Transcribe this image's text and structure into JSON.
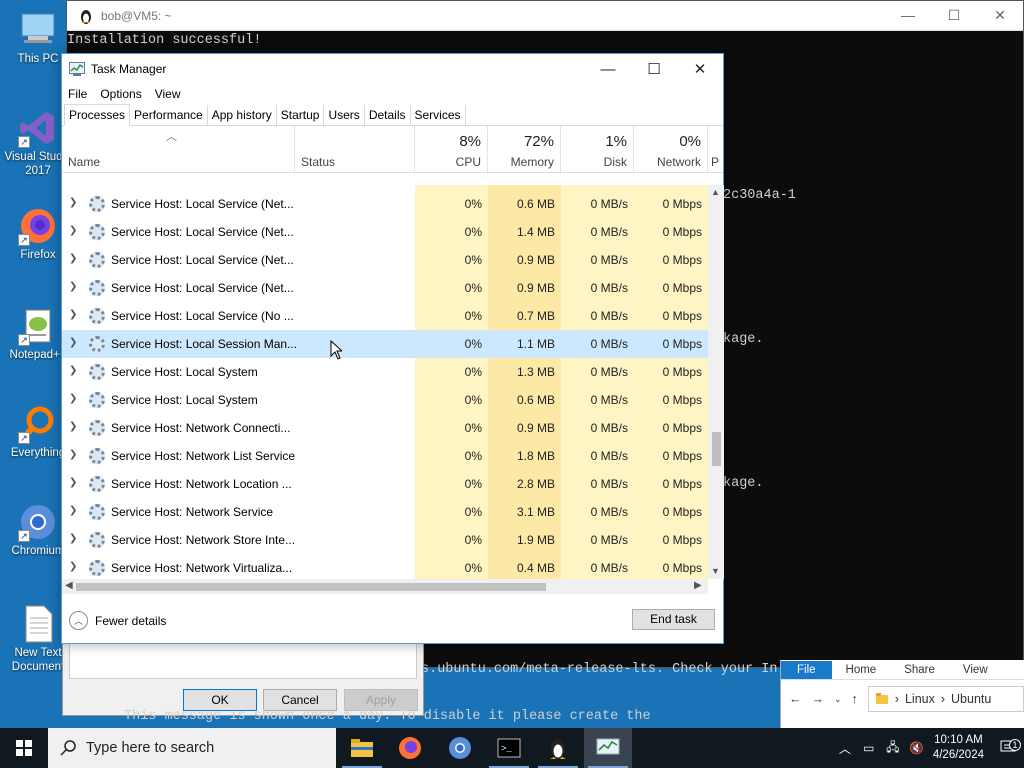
{
  "desktop": {
    "icons": [
      {
        "label": "This PC"
      },
      {
        "label": "Visual Studio 2017"
      },
      {
        "label": "Firefox"
      },
      {
        "label": "Notepad++"
      },
      {
        "label": "Everything"
      },
      {
        "label": "Chromium"
      },
      {
        "label": "New Text Document"
      }
    ]
  },
  "terminal": {
    "title": "bob@VM5: ~",
    "lines": {
      "l1": "Installation successful!",
      "l2": "2c30a4a-1",
      "l3": "kage.",
      "l4": "kage.",
      "l5": "s.ubuntu.com/meta-release-lts. Check your In",
      "l6": "This message is shown once a day. To disable it please create the"
    }
  },
  "explorer": {
    "tabs": [
      "File",
      "Home",
      "Share",
      "View"
    ],
    "path": [
      "Linux",
      "Ubuntu"
    ]
  },
  "properties_dialog": {
    "ok": "OK",
    "cancel": "Cancel",
    "apply": "Apply"
  },
  "task_manager": {
    "title": "Task Manager",
    "menu": [
      "File",
      "Options",
      "View"
    ],
    "tabs": [
      "Processes",
      "Performance",
      "App history",
      "Startup",
      "Users",
      "Details",
      "Services"
    ],
    "active_tab": "Processes",
    "columns": {
      "name": "Name",
      "status": "Status",
      "cpu": {
        "pct": "8%",
        "label": "CPU"
      },
      "memory": {
        "pct": "72%",
        "label": "Memory"
      },
      "disk": {
        "pct": "1%",
        "label": "Disk"
      },
      "network": {
        "pct": "0%",
        "label": "Network"
      },
      "power": "P"
    },
    "rows": [
      {
        "name": "Service Host: Local Service (Net...",
        "cpu": "0%",
        "memory": "0.6 MB",
        "disk": "0 MB/s",
        "network": "0 Mbps"
      },
      {
        "name": "Service Host: Local Service (Net...",
        "cpu": "0%",
        "memory": "1.4 MB",
        "disk": "0 MB/s",
        "network": "0 Mbps"
      },
      {
        "name": "Service Host: Local Service (Net...",
        "cpu": "0%",
        "memory": "0.9 MB",
        "disk": "0 MB/s",
        "network": "0 Mbps"
      },
      {
        "name": "Service Host: Local Service (Net...",
        "cpu": "0%",
        "memory": "0.9 MB",
        "disk": "0 MB/s",
        "network": "0 Mbps"
      },
      {
        "name": "Service Host: Local Service (No ...",
        "cpu": "0%",
        "memory": "0.7 MB",
        "disk": "0 MB/s",
        "network": "0 Mbps"
      },
      {
        "name": "Service Host: Local Session Man...",
        "cpu": "0%",
        "memory": "1.1 MB",
        "disk": "0 MB/s",
        "network": "0 Mbps",
        "selected": true
      },
      {
        "name": "Service Host: Local System",
        "cpu": "0%",
        "memory": "1.3 MB",
        "disk": "0 MB/s",
        "network": "0 Mbps"
      },
      {
        "name": "Service Host: Local System",
        "cpu": "0%",
        "memory": "0.6 MB",
        "disk": "0 MB/s",
        "network": "0 Mbps"
      },
      {
        "name": "Service Host: Network Connecti...",
        "cpu": "0%",
        "memory": "0.9 MB",
        "disk": "0 MB/s",
        "network": "0 Mbps"
      },
      {
        "name": "Service Host: Network List Service",
        "cpu": "0%",
        "memory": "1.8 MB",
        "disk": "0 MB/s",
        "network": "0 Mbps"
      },
      {
        "name": "Service Host: Network Location ...",
        "cpu": "0%",
        "memory": "2.8 MB",
        "disk": "0 MB/s",
        "network": "0 Mbps"
      },
      {
        "name": "Service Host: Network Service",
        "cpu": "0%",
        "memory": "3.1 MB",
        "disk": "0 MB/s",
        "network": "0 Mbps"
      },
      {
        "name": "Service Host: Network Store Inte...",
        "cpu": "0%",
        "memory": "1.9 MB",
        "disk": "0 MB/s",
        "network": "0 Mbps"
      },
      {
        "name": "Service Host: Network Virtualiza...",
        "cpu": "0%",
        "memory": "0.4 MB",
        "disk": "0 MB/s",
        "network": "0 Mbps"
      }
    ],
    "fewer_details": "Fewer details",
    "end_task": "End task"
  },
  "taskbar": {
    "search_placeholder": "Type here to search",
    "time": "10:10 AM",
    "date": "4/26/2024",
    "notification_count": "1"
  },
  "colors": {
    "desktop": "#1973b6",
    "cpu_column": "#fff4c4",
    "memory_column": "#fce9a6",
    "selected_row": "#cce8ff",
    "taskbar": "#101820"
  }
}
